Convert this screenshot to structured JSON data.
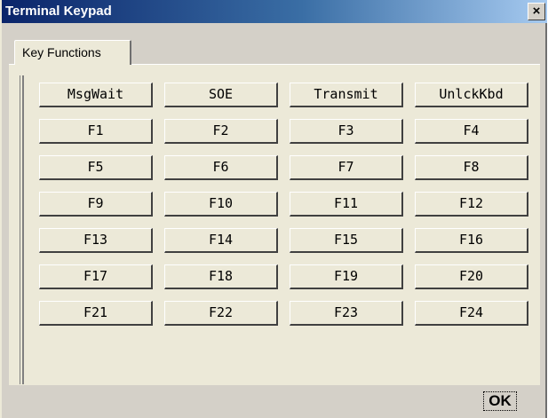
{
  "window": {
    "title": "Terminal Keypad",
    "close_label": "×"
  },
  "tabs": [
    {
      "label": "Key Functions"
    }
  ],
  "keys": [
    "MsgWait",
    "SOE",
    "Transmit",
    "UnlckKbd",
    "F1",
    "F2",
    "F3",
    "F4",
    "F5",
    "F6",
    "F7",
    "F8",
    "F9",
    "F10",
    "F11",
    "F12",
    "F13",
    "F14",
    "F15",
    "F16",
    "F17",
    "F18",
    "F19",
    "F20",
    "F21",
    "F22",
    "F23",
    "F24"
  ],
  "footer": {
    "ok_label": "OK"
  }
}
